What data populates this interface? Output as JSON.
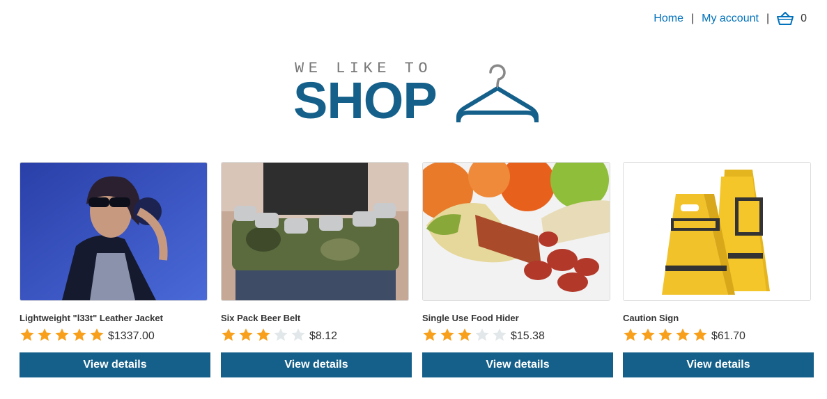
{
  "nav": {
    "home": "Home",
    "separator": "|",
    "account": "My account",
    "cart_icon": "basket-icon",
    "cart_count": "0"
  },
  "logo": {
    "line1": "WE LIKE TO",
    "line2": "SHOP",
    "icon": "hanger-icon"
  },
  "colors": {
    "link": "#0071bc",
    "brand": "#14608a",
    "star_on": "#f8a01c",
    "star_off": "#e2e8ea"
  },
  "products": [
    {
      "title": "Lightweight \"l33t\" Leather Jacket",
      "rating": 5,
      "price": "$1337.00",
      "button": "View details"
    },
    {
      "title": "Six Pack Beer Belt",
      "rating": 3,
      "price": "$8.12",
      "button": "View details"
    },
    {
      "title": "Single Use Food Hider",
      "rating": 3,
      "price": "$15.38",
      "button": "View details"
    },
    {
      "title": "Caution Sign",
      "rating": 5,
      "price": "$61.70",
      "button": "View details"
    }
  ]
}
